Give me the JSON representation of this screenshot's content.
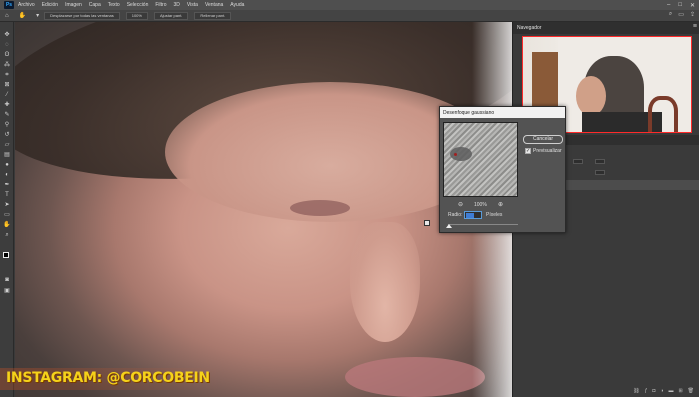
{
  "app": {
    "logo": "Ps",
    "menu": [
      "Archivo",
      "Edición",
      "Imagen",
      "Capa",
      "Texto",
      "Selección",
      "Filtro",
      "3D",
      "Vista",
      "Ventana",
      "Ayuda"
    ]
  },
  "options_bar": {
    "scroll_all_label": "Desplazarse por todas las ventanas",
    "zoom_value": "100%",
    "fit_label": "Ajustar pant.",
    "fill_label": "Rellenar pant."
  },
  "navigator": {
    "title": "Navegador"
  },
  "dialog": {
    "title": "Desenfoque gaussiano",
    "zoom": "100%",
    "cancel_label": "Cancelar",
    "preview_label": "Previsualizar",
    "preview_checked": true,
    "radius_label": "Radio:",
    "radius_value": "",
    "unit_label": "Píxeles"
  },
  "watermark": {
    "text": "INSTAGRAM: @CORCOBEIN"
  },
  "colors": {
    "accent": "#31a8ff",
    "watermark": "#f5d21a",
    "viewbox": "#ff2a2a"
  }
}
